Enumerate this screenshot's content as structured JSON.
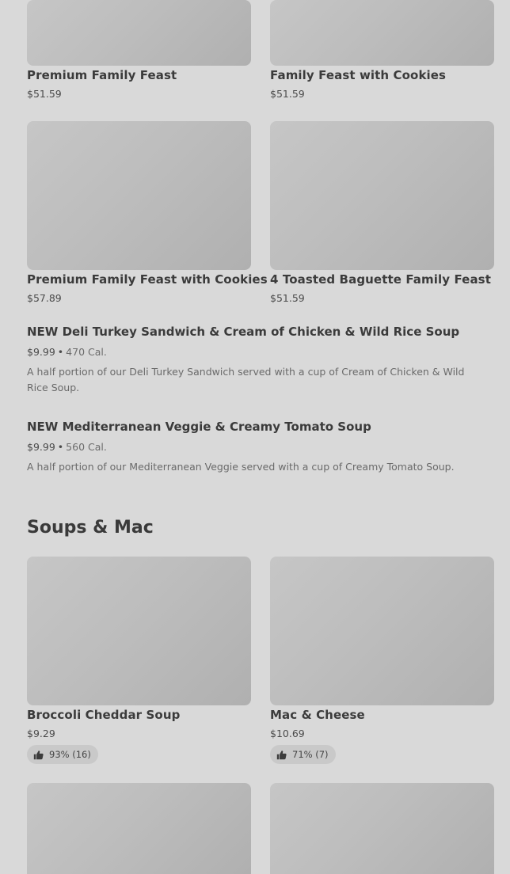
{
  "colors": {
    "thumb_placeholder": "#bdbdbd",
    "badge_bg": "#c9c9c9"
  },
  "icons": {
    "rating": "thumbs-up-icon"
  },
  "menu": {
    "family_cards": [
      {
        "title": "Premium Family Feast",
        "price": "$51.59"
      },
      {
        "title": "Family Feast with Cookies",
        "price": "$51.59"
      },
      {
        "title": "Premium Family Feast with Cookies",
        "price": "$57.89"
      },
      {
        "title": "4 Toasted Baguette Family Feast",
        "price": "$51.59"
      }
    ],
    "combos": [
      {
        "title": "NEW Deli Turkey Sandwich & Cream of Chicken & Wild Rice Soup",
        "price": "$9.99",
        "separator": "•",
        "calories": "470 Cal.",
        "description": "A half portion of our Deli Turkey Sandwich served with a cup of Cream of Chicken & Wild Rice Soup."
      },
      {
        "title": "NEW Mediterranean Veggie & Creamy Tomato Soup",
        "price": "$9.99",
        "separator": "•",
        "calories": "560 Cal.",
        "description": "A half portion of our Mediterranean Veggie served with a cup of Creamy Tomato Soup."
      }
    ],
    "soups_section": {
      "title": "Soups & Mac",
      "cards": [
        {
          "title": "Broccoli Cheddar Soup",
          "price": "$9.29",
          "rating": "93% (16)"
        },
        {
          "title": "Mac & Cheese",
          "price": "$10.69",
          "rating": "71% (7)"
        }
      ]
    }
  }
}
